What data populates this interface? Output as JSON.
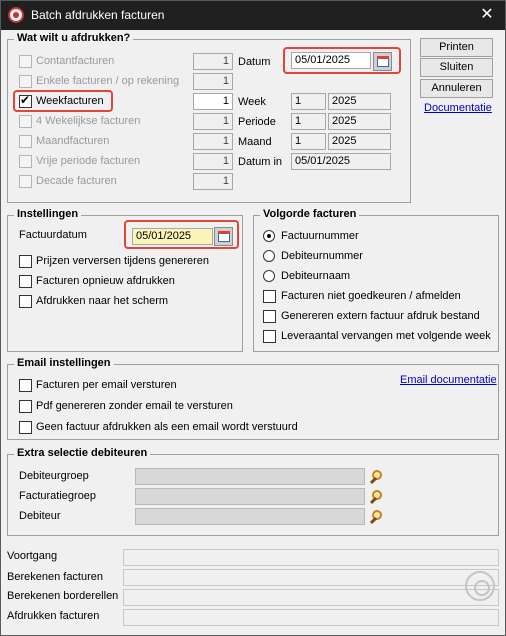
{
  "window": {
    "title": "Batch afdrukken facturen",
    "close_glyph": "✕"
  },
  "buttons": {
    "printen": "Printen",
    "sluiten": "Sluiten",
    "annuleren": "Annuleren",
    "documentatie": "Documentatie"
  },
  "what": {
    "title": "Wat wilt u afdrukken?",
    "options": [
      {
        "label": "Contantfacturen",
        "count": "1",
        "checked": false,
        "enabled": false
      },
      {
        "label": "Enkele facturen / op rekening",
        "count": "1",
        "checked": false,
        "enabled": false
      },
      {
        "label": "Weekfacturen",
        "count": "1",
        "checked": true,
        "enabled": true
      },
      {
        "label": "4 Wekelijkse facturen",
        "count": "1",
        "checked": false,
        "enabled": false
      },
      {
        "label": "Maandfacturen",
        "count": "1",
        "checked": false,
        "enabled": false
      },
      {
        "label": "Vrije periode facturen",
        "count": "1",
        "checked": false,
        "enabled": false
      },
      {
        "label": "Decade facturen",
        "count": "1",
        "checked": false,
        "enabled": false
      }
    ],
    "datum_label": "Datum",
    "datum_value": "05/01/2025",
    "week_label": "Week",
    "week_value": "1",
    "week_year": "2025",
    "periode_label": "Periode",
    "periode_value": "1",
    "periode_year": "2025",
    "maand_label": "Maand",
    "maand_value": "1",
    "maand_year": "2025",
    "datum_in_label": "Datum in",
    "datum_in_value": "05/01/2025"
  },
  "instellingen": {
    "title": "Instellingen",
    "factuurdatum_label": "Factuurdatum",
    "factuurdatum_value": "05/01/2025",
    "options": [
      {
        "label": "Prijzen verversen tijdens genereren",
        "checked": false
      },
      {
        "label": "Facturen opnieuw afdrukken",
        "checked": false
      },
      {
        "label": "Afdrukken naar het scherm",
        "checked": false
      }
    ]
  },
  "volgorde": {
    "title": "Volgorde facturen",
    "radios": [
      {
        "label": "Factuurnummer",
        "checked": true
      },
      {
        "label": "Debiteurnummer",
        "checked": false
      },
      {
        "label": "Debiteurnaam",
        "checked": false
      }
    ],
    "options": [
      {
        "label": "Facturen niet goedkeuren / afmelden",
        "checked": false
      },
      {
        "label": "Genereren extern factuur afdruk bestand",
        "checked": false
      },
      {
        "label": "Leveraantal vervangen met volgende week",
        "checked": false
      }
    ]
  },
  "email": {
    "title": "Email instellingen",
    "doc_link": "Email documentatie",
    "options": [
      {
        "label": "Facturen per email versturen",
        "checked": false
      },
      {
        "label": "Pdf genereren zonder email te versturen",
        "checked": false
      },
      {
        "label": "Geen factuur afdrukken als een email wordt verstuurd",
        "checked": false
      }
    ]
  },
  "extra": {
    "title": "Extra selectie debiteuren",
    "fields": [
      {
        "label": "Debiteurgroep",
        "value": ""
      },
      {
        "label": "Facturatiegroep",
        "value": ""
      },
      {
        "label": "Debiteur",
        "value": ""
      }
    ]
  },
  "status": {
    "voortgang": "Voortgang",
    "berekenen_facturen": "Berekenen facturen",
    "berekenen_borderellen": "Berekenen borderellen",
    "afdrukken_facturen": "Afdrukken facturen"
  },
  "colors": {
    "highlight": "#e0453a",
    "link": "#0000cc",
    "titlebar": "#202020"
  }
}
